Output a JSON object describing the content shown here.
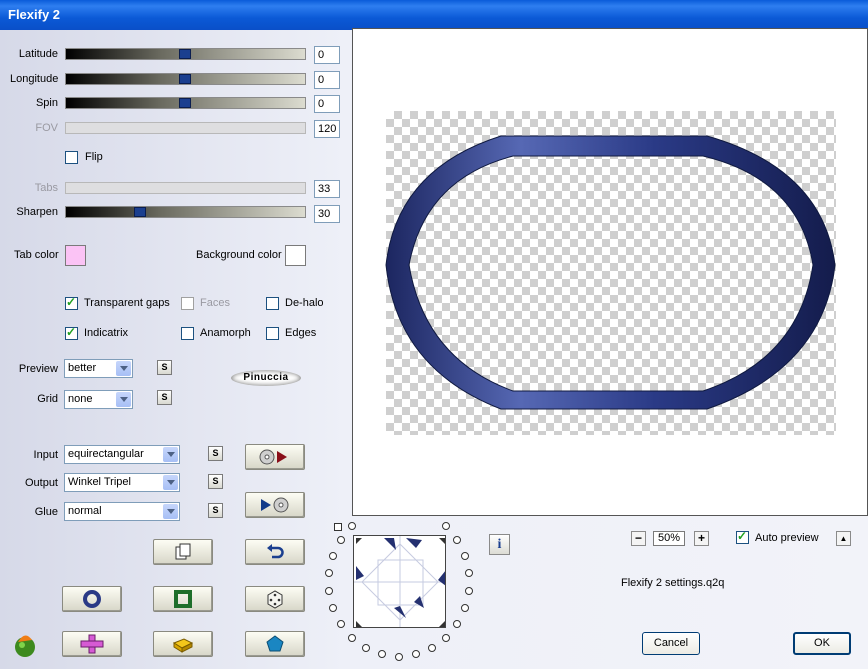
{
  "window": {
    "title": "Flexify 2"
  },
  "sliders": [
    {
      "label": "Latitude",
      "value": "0",
      "enabled": true,
      "fraction": 0.5
    },
    {
      "label": "Longitude",
      "value": "0",
      "enabled": true,
      "fraction": 0.5
    },
    {
      "label": "Spin",
      "value": "0",
      "enabled": true,
      "fraction": 0.5
    },
    {
      "label": "FOV",
      "value": "120",
      "enabled": false
    },
    {
      "label": "Tabs",
      "value": "33",
      "enabled": false
    },
    {
      "label": "Sharpen",
      "value": "30",
      "enabled": true,
      "fraction": 0.3
    }
  ],
  "flip": {
    "label": "Flip",
    "checked": false
  },
  "tab_color": {
    "label": "Tab color",
    "color": "#fbc3f5"
  },
  "background_color": {
    "label": "Background color",
    "color": "#ffffff"
  },
  "options": {
    "transparent_gaps": {
      "label": "Transparent gaps",
      "checked": true
    },
    "faces": {
      "label": "Faces",
      "checked": false,
      "enabled": false
    },
    "de_halo": {
      "label": "De-halo",
      "checked": false
    },
    "indicatrix": {
      "label": "Indicatrix",
      "checked": true
    },
    "anamorph": {
      "label": "Anamorph",
      "checked": false
    },
    "edges": {
      "label": "Edges",
      "checked": false
    }
  },
  "preview_quality": {
    "label": "Preview",
    "value": "better"
  },
  "grid": {
    "label": "Grid",
    "value": "none"
  },
  "watermark": {
    "text": "Pinuccia"
  },
  "input": {
    "label": "Input",
    "value": "equirectangular"
  },
  "output": {
    "label": "Output",
    "value": "Winkel Tripel"
  },
  "glue": {
    "label": "Glue",
    "value": "normal"
  },
  "small_button_label": "S",
  "zoom": {
    "value": "50%",
    "minus": "−",
    "plus": "+"
  },
  "auto_preview": {
    "label": "Auto preview",
    "checked": true
  },
  "settings_file": "Flexify 2 settings.q2q",
  "buttons": {
    "cancel": "Cancel",
    "ok": "OK",
    "info": "i",
    "collapse": "▲"
  },
  "colors": {
    "accent": "#0a5bd9",
    "band": "#2a3a86",
    "check": "#21a121"
  }
}
